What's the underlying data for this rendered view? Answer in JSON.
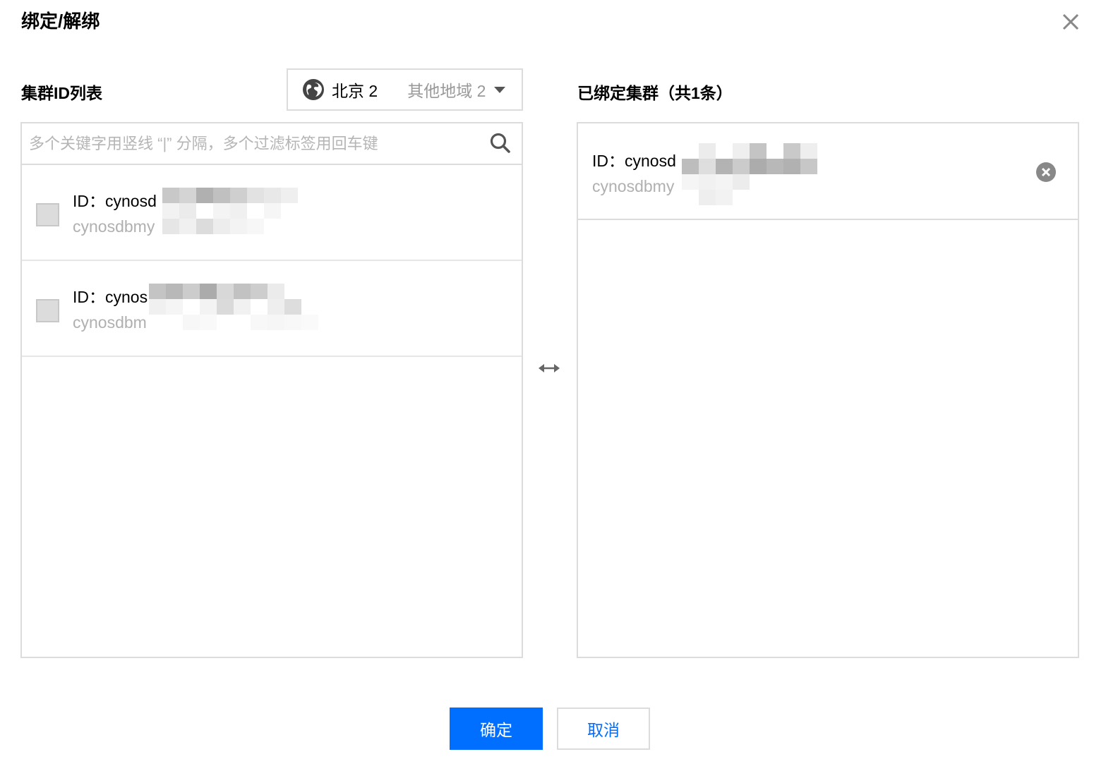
{
  "dialog": {
    "title": "绑定/解绑",
    "close_icon": "close-icon"
  },
  "left": {
    "title": "集群ID列表",
    "region": {
      "current": "北京 2",
      "other": "其他地域 2",
      "icon": "globe-icon"
    },
    "search": {
      "placeholder": "多个关键字用竖线 “|” 分隔，多个过滤标签用回车键",
      "icon": "search-icon"
    },
    "items": [
      {
        "id_label": "ID：cynosd",
        "sub_label": "cynosdbmy",
        "checked": false
      },
      {
        "id_label": "ID：cynos",
        "sub_label": "cynosdbm",
        "checked": false
      }
    ]
  },
  "transfer_icon": "bidirectional-arrow-icon",
  "right": {
    "title": "已绑定集群（共1条）",
    "items": [
      {
        "id_label": "ID：cynosd",
        "sub_label": "cynosdbmy"
      }
    ]
  },
  "footer": {
    "confirm_label": "确定",
    "cancel_label": "取消"
  },
  "colors": {
    "primary": "#006eff",
    "border": "#dcdcdc",
    "muted_text": "#b0b0b0"
  }
}
